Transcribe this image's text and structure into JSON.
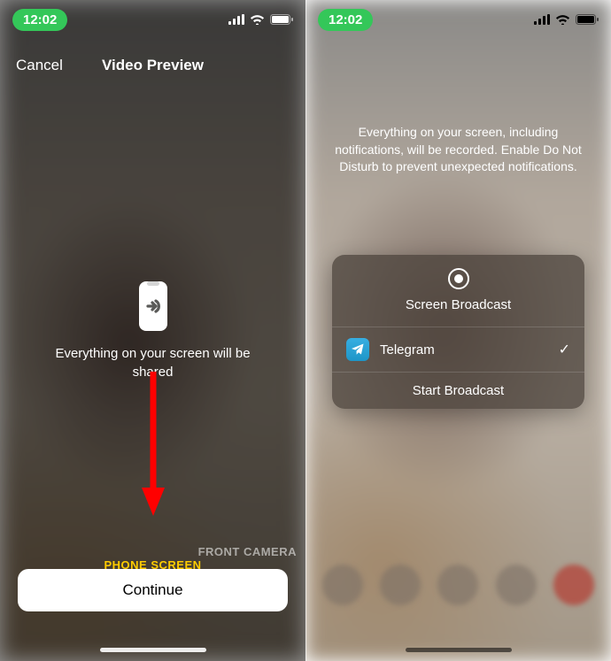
{
  "status": {
    "time": "12:02"
  },
  "left": {
    "cancel": "Cancel",
    "title": "Video Preview",
    "message": "Everything on your screen will be shared",
    "tab_phone": "PHONE SCREEN",
    "tab_front": "FRONT CAMERA",
    "continue": "Continue"
  },
  "right": {
    "top_message": "Everything on your screen, including notifications, will be recorded. Enable Do Not Disturb to prevent unexpected notifications.",
    "card_title": "Screen Broadcast",
    "app_name": "Telegram",
    "start": "Start Broadcast"
  }
}
